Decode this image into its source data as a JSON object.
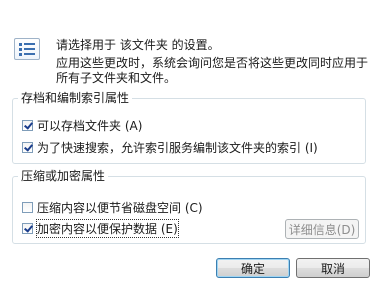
{
  "intro": {
    "line1": "请选择用于 该文件夹 的设置。",
    "line2": "应用这些更改时，系统会询问您是否将这些更改同时应用于所有子文件夹和文件。"
  },
  "archive_group": {
    "legend": "存档和编制索引属性",
    "items": [
      {
        "label": "可以存档文件夹 (A)",
        "checked": true
      },
      {
        "label": "为了快速搜索，允许索引服务编制该文件夹的索引 (I)",
        "checked": true
      }
    ]
  },
  "compress_group": {
    "legend": "压缩或加密属性",
    "items": [
      {
        "label": "压缩内容以便节省磁盘空间 (C)",
        "checked": false
      },
      {
        "label": "加密内容以便保护数据 (E)",
        "checked": true
      }
    ],
    "details_label": "详细信息(D)"
  },
  "buttons": {
    "ok": "确定",
    "cancel": "取消"
  },
  "icons": {
    "info": "list-icon"
  }
}
